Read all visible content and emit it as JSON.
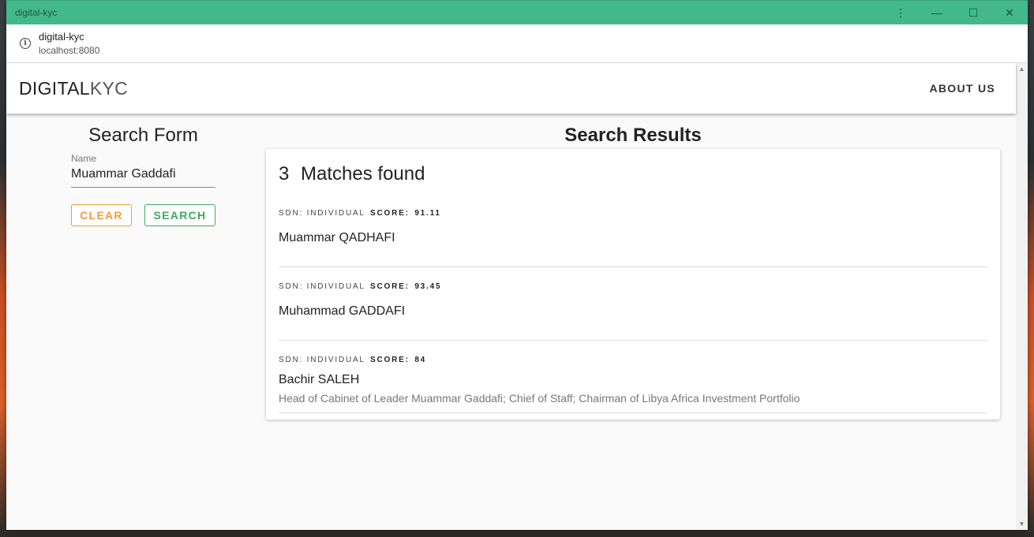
{
  "window": {
    "title": "digital-kyc"
  },
  "addressbar": {
    "page_title": "digital-kyc",
    "url": "localhost:8080"
  },
  "appbar": {
    "brand_bold": "DIGITAL",
    "brand_light": "KYC",
    "about_label": "ABOUT US"
  },
  "search_form": {
    "title": "Search Form",
    "name_label": "Name",
    "name_value": "Muammar Gaddafi",
    "clear_label": "CLEAR",
    "search_label": "SEARCH"
  },
  "results": {
    "title": "Search Results",
    "count": "3",
    "count_label": "Matches found",
    "items": [
      {
        "type": "SDN: INDIVIDUAL",
        "score_label": "SCORE:",
        "score": "91.11",
        "name": "Muammar QADHAFI",
        "remark": ""
      },
      {
        "type": "SDN: INDIVIDUAL",
        "score_label": "SCORE:",
        "score": "93.45",
        "name": "Muhammad GADDAFI",
        "remark": ""
      },
      {
        "type": "SDN: INDIVIDUAL",
        "score_label": "SCORE:",
        "score": "84",
        "name": "Bachir SALEH",
        "remark": "Head of Cabinet of Leader Muammar Gaddafi; Chief of Staff; Chairman of Libya Africa Investment Portfolio"
      }
    ]
  },
  "colors": {
    "titlebar": "#43b98b",
    "clear": "#f29c3a",
    "search": "#3daa5f"
  }
}
